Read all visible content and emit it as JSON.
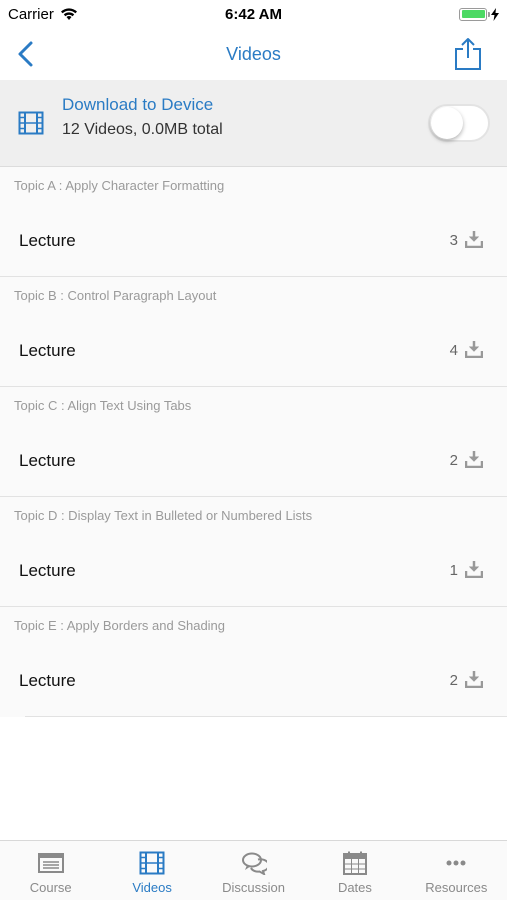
{
  "status_bar": {
    "carrier": "Carrier",
    "time": "6:42 AM",
    "battery_color": "#4cd964"
  },
  "nav": {
    "title": "Videos",
    "back_icon": "chevron-left-icon",
    "share_icon": "share-icon",
    "accent_color": "#2a7bc4"
  },
  "download": {
    "title": "Download to Device",
    "subtitle": "12 Videos, 0.0MB total",
    "icon": "film-icon",
    "toggle_on": false
  },
  "sections": [
    {
      "header": "Topic A : Apply Character Formatting",
      "row_label": "Lecture",
      "count": "3"
    },
    {
      "header": "Topic B : Control Paragraph Layout",
      "row_label": "Lecture",
      "count": "4"
    },
    {
      "header": "Topic C : Align Text Using Tabs",
      "row_label": "Lecture",
      "count": "2"
    },
    {
      "header": "Topic D : Display Text in Bulleted or Numbered Lists",
      "row_label": "Lecture",
      "count": "1"
    },
    {
      "header": "Topic E : Apply Borders and Shading",
      "row_label": "Lecture",
      "count": "2"
    }
  ],
  "tabs": [
    {
      "label": "Course",
      "icon": "course-icon",
      "active": false
    },
    {
      "label": "Videos",
      "icon": "film-icon",
      "active": true
    },
    {
      "label": "Discussion",
      "icon": "chat-bubbles-icon",
      "active": false
    },
    {
      "label": "Dates",
      "icon": "calendar-icon",
      "active": false
    },
    {
      "label": "Resources",
      "icon": "more-dots-icon",
      "active": false
    }
  ]
}
